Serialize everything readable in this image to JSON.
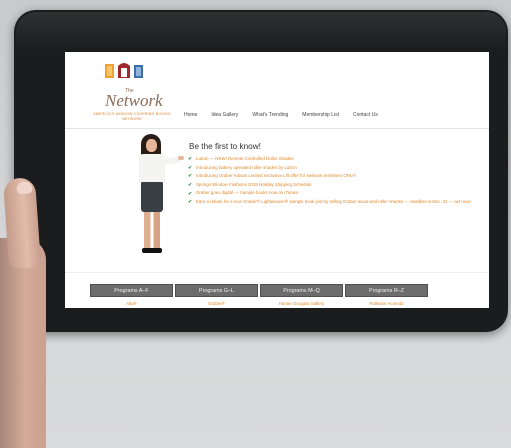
{
  "logo": {
    "the": "The",
    "name": "Network",
    "tagline": "AMERICA'S WINDOW COVERING BUYING NETWORK"
  },
  "nav": [
    "Home",
    "Idea Gallery",
    "What's Trending",
    "Membership List",
    "Contact Us"
  ],
  "headline": "Be the first to know!",
  "news": [
    "Lutron — NEW! Remote-Controlled Roller Shades",
    "Introducing battery operated roller shades by Lutron",
    "Introducing Graber Artisan Limited exclusive Lift offer for Network members ONLY!",
    "Springs Window Fashions 2019 Holiday Shipping Schedule",
    "Graber goes digital — Sample books now on iTunes!",
    "Earn a rebate for a new Graber® Lightweaver® sample book just by selling Graber wood and roller shades — deadline is Dec. 31 — act now!"
  ],
  "program_tabs": [
    "Programs A–F",
    "Programs G–L",
    "Programs M–Q",
    "Programs R–Z"
  ],
  "program_sublinks": [
    "Alta®",
    "Graber®",
    "Hunter Douglas Gallery",
    "Rollease Acmeda"
  ],
  "colors": {
    "accent": "#e0892c",
    "tab_bg": "#6c6c6c",
    "bezel": "#1b1c1e",
    "check": "#1d6c2b"
  }
}
